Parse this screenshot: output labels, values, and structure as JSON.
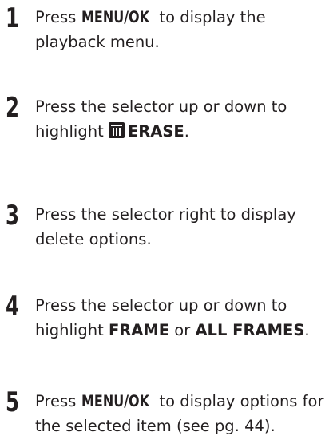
{
  "steps": [
    {
      "number": "1",
      "line1_pre": "Press ",
      "line1_key": "MENU/OK",
      "line1_post": " to display the",
      "line2": "playback menu."
    },
    {
      "number": "2",
      "line1": "Press the selector up or down to",
      "line2_pre": "highlight ",
      "line2_icon": "trash-icon",
      "line2_bold": "ERASE",
      "line2_post": "."
    },
    {
      "number": "3",
      "line1": "Press the selector right to display",
      "line2": "delete options."
    },
    {
      "number": "4",
      "line1": "Press the selector up or down to",
      "line2_pre": "highlight ",
      "line2_bold1": "FRAME",
      "line2_mid": " or ",
      "line2_bold2": "ALL FRAMES",
      "line2_post": "."
    },
    {
      "number": "5",
      "line1_pre": "Press ",
      "line1_key": "MENU/OK",
      "line1_post": " to display options for",
      "line2": "the selected item (see pg. 44)."
    }
  ]
}
